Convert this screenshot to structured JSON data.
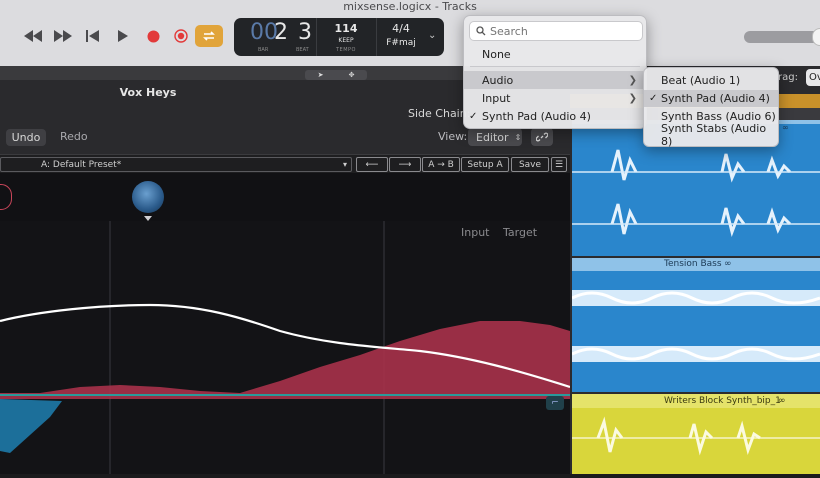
{
  "window": {
    "title": "mixsense.logicx - Tracks"
  },
  "lcd": {
    "bar_digits": "2",
    "bar_label": "BAR",
    "beat_digits": "3",
    "beat_label": "BEAT",
    "tempo": "114",
    "tempo_mode": "KEEP",
    "tempo_label": "TEMPO",
    "time_sig": "4/4",
    "key": "F#maj"
  },
  "plugin": {
    "title": "Vox Heys",
    "side_chain_label": "Side Chain:",
    "undo": "Undo",
    "redo": "Redo",
    "view_label": "View:",
    "view_value": "Editor",
    "preset": "A: Default Preset*",
    "a_to_b": "A → B",
    "setup_a": "Setup A",
    "save": "Save",
    "legend_input": "Input",
    "legend_target": "Target"
  },
  "tracks": {
    "drag_label": "rag:",
    "drag_value": "Ov",
    "track2_name": "Tension Bass",
    "track3_name": "Writers Block Synth_bip_1"
  },
  "menu": {
    "search_placeholder": "Search",
    "items": [
      {
        "label": "None",
        "checked": false,
        "submenu": false
      },
      {
        "label": "Audio",
        "checked": false,
        "submenu": true,
        "highlighted": true
      },
      {
        "label": "Input",
        "checked": false,
        "submenu": true
      },
      {
        "label": "Synth Pad (Audio 4)",
        "checked": true,
        "submenu": false
      }
    ]
  },
  "submenu": {
    "items": [
      {
        "label": "Beat (Audio 1)",
        "checked": false
      },
      {
        "label": "Synth Pad (Audio 4)",
        "checked": true,
        "highlighted": true
      },
      {
        "label": "Synth Bass (Audio 6)",
        "checked": false
      },
      {
        "label": "Synth Stabs (Audio 8)",
        "checked": false
      }
    ]
  },
  "colors": {
    "accent_orange": "#e1a43a",
    "record_red": "#e23a3a",
    "track_blue": "#2a86cc",
    "track_yellow": "#d9d63b",
    "input_curve": "#ffffff",
    "target_fill": "#a8324a",
    "teal_line": "#2a9a9a",
    "menu_highlight": "#c9c9cd"
  }
}
